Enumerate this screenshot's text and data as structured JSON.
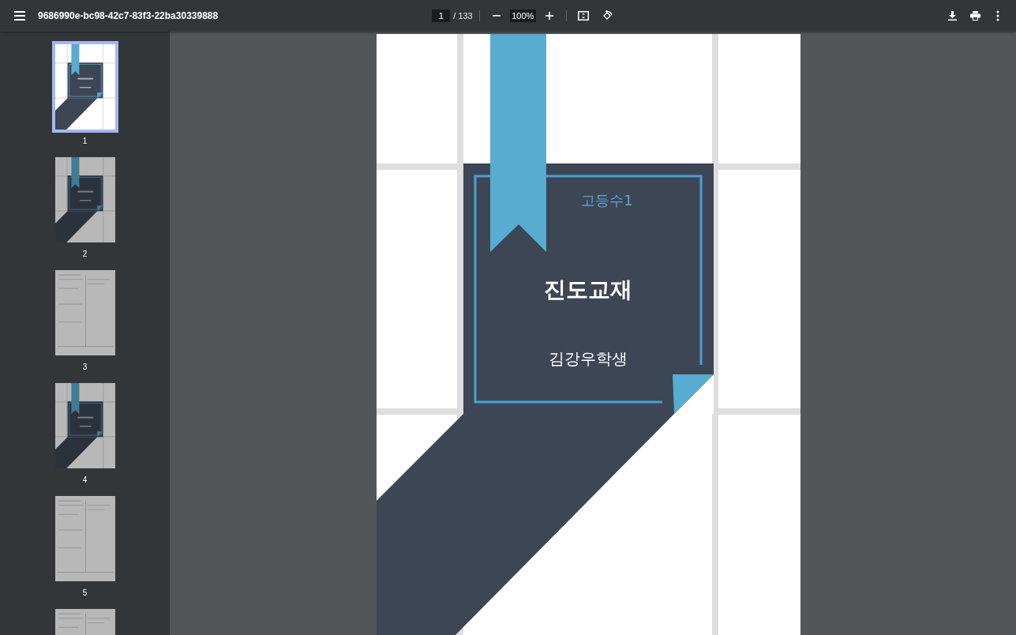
{
  "toolbar": {
    "title": "9686990e-bc98-42c7-83f3-22ba30339888",
    "page_number": "1",
    "page_total": "/ 133",
    "zoom": "100%"
  },
  "thumbnails": [
    {
      "page": "1",
      "kind": "cover",
      "selected": true
    },
    {
      "page": "2",
      "kind": "cover",
      "selected": false
    },
    {
      "page": "3",
      "kind": "text",
      "selected": false
    },
    {
      "page": "4",
      "kind": "cover",
      "selected": false
    },
    {
      "page": "5",
      "kind": "text",
      "selected": false
    },
    {
      "kind": "text",
      "selected": false
    }
  ],
  "page": {
    "subject": "고등수1",
    "title": "진도교재",
    "student": "김강우학생"
  }
}
